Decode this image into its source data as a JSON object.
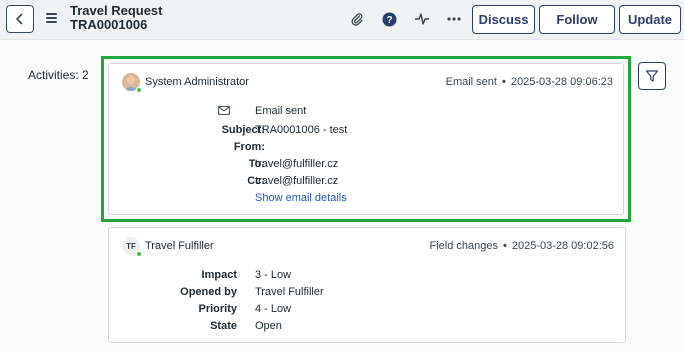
{
  "header": {
    "title": "Travel Request",
    "number": "TRA0001006",
    "icons": [
      "back-chevron-icon",
      "menu-icon",
      "paperclip-icon",
      "help-icon",
      "activity-icon",
      "more-icon"
    ],
    "buttons": {
      "discuss": "Discuss",
      "follow": "Follow",
      "update": "Update"
    }
  },
  "activities": {
    "label": "Activities: 2",
    "filter_icon": "filter-icon"
  },
  "entries": [
    {
      "author": "System Administrator",
      "type": "Email sent",
      "timestamp": "2025-03-28 09:06:23",
      "email_heading": "Email sent",
      "fields": [
        {
          "label": "Subject:",
          "value": "TRA0001006 - test"
        },
        {
          "label": "From:",
          "value": ""
        },
        {
          "label": "To:",
          "value": "travel@fulfiller.cz"
        },
        {
          "label": "Cc:",
          "value": "travel@fulfiller.cz"
        }
      ],
      "link": "Show email details"
    },
    {
      "author": "Travel Fulfiller",
      "initials": "TF",
      "type": "Field changes",
      "timestamp": "2025-03-28 09:02:56",
      "fields": [
        {
          "label": "Impact",
          "value": "3 - Low"
        },
        {
          "label": "Opened by",
          "value": "Travel Fulfiller"
        },
        {
          "label": "Priority",
          "value": "4 - Low"
        },
        {
          "label": "State",
          "value": "Open"
        }
      ]
    }
  ],
  "colors": {
    "accent": "#2c3e6b",
    "highlight": "#22a83a",
    "presence": "#4cbb54",
    "link": "#2a5bb8"
  }
}
